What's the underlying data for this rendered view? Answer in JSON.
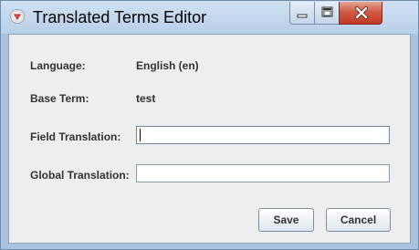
{
  "window": {
    "title": "Translated Terms Editor",
    "icon": "app-logo-icon",
    "controls": {
      "minimize": "minimize-icon",
      "maximize": "maximize-icon",
      "close": "close-icon"
    }
  },
  "form": {
    "language_label": "Language:",
    "language_value": "English (en)",
    "base_term_label": "Base Term:",
    "base_term_value": "test",
    "field_translation_label": "Field Translation:",
    "field_translation_value": "",
    "global_translation_label": "Global Translation:",
    "global_translation_value": ""
  },
  "buttons": {
    "save": "Save",
    "cancel": "Cancel"
  },
  "colors": {
    "titlebar": "#b9d0e9",
    "close_button": "#c23a26",
    "dialog_background": "#eeeeee",
    "text": "#333333"
  }
}
